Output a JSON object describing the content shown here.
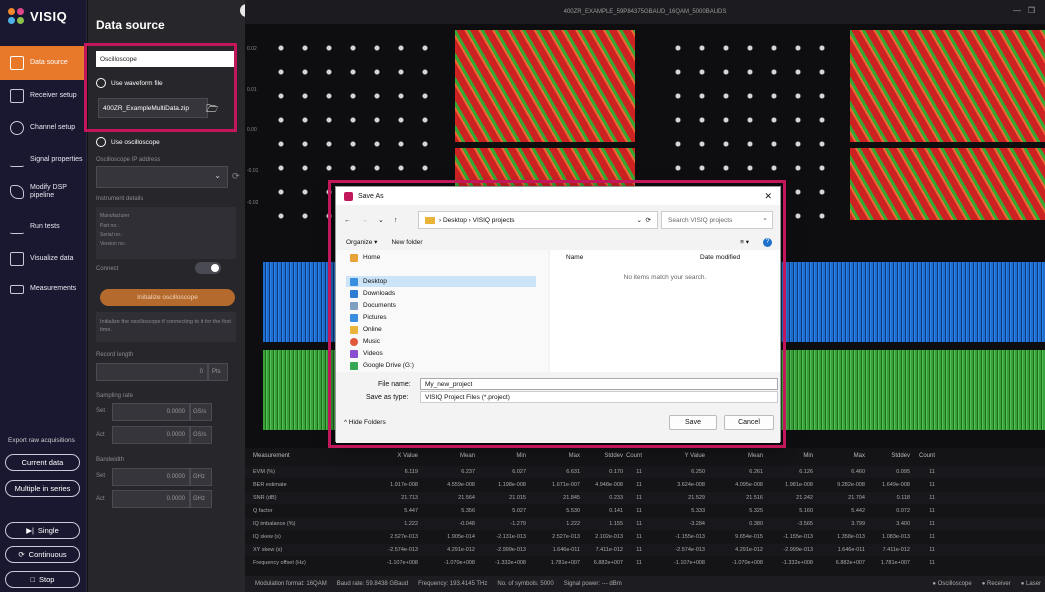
{
  "nav": {
    "logo": "VISIQ",
    "items": [
      {
        "label": "Data source"
      },
      {
        "label": "Receiver setup"
      },
      {
        "label": "Channel setup"
      },
      {
        "label": "Signal properties"
      },
      {
        "label": "Modify DSP pipeline"
      },
      {
        "label": "Run tests"
      },
      {
        "label": "Visualize data"
      },
      {
        "label": "Measurements"
      }
    ],
    "export_title": "Export raw acquisitions",
    "current_data": "Current data",
    "multiple_series": "Multiple in series",
    "single": "Single",
    "continuous": "Continuous",
    "stop": "Stop"
  },
  "panel": {
    "title": "Data source",
    "section": "Oscilloscope",
    "use_waveform": "Use waveform file",
    "waveform_file": "400ZR_ExampleMultiData.zip",
    "use_oscilloscope": "Use oscilloscope",
    "ip_label": "Oscilloscope IP address",
    "instrument_details": "Instrument details",
    "manufacturer": "Manufacturer",
    "part_no": "Part no.:",
    "serial_no": "Serial no.:",
    "version_no": "Version no.:",
    "connect": "Connect",
    "init_button": "Initialize oscilloscope",
    "init_note": "Initialize the oscilloscope if connecting to it for the first time.",
    "record_length": "Record length",
    "record_value": "0",
    "record_unit": "Pts",
    "sampling_rate": "Sampling rate",
    "set": "Set",
    "act": "Act",
    "sr_set": "0.0000",
    "sr_act": "0.0000",
    "sr_unit": "GS/s",
    "bandwidth": "Bandwidth",
    "bw_set": "0.0000",
    "bw_act": "0.0000",
    "bw_unit": "GHz"
  },
  "main": {
    "window_title": "400ZR_EXAMPLE_59P84375GBAUD_16QAM_5000BAUDS",
    "axis": {
      "t1": "0.02",
      "t2": "0.01",
      "t3": "0.00",
      "t4": "-0.01",
      "t5": "-0.02"
    }
  },
  "table": {
    "headers": [
      "Measurement",
      "X Value",
      "Mean",
      "Min",
      "Max",
      "Stddev",
      "Count",
      "Y Value",
      "Mean",
      "Min",
      "Max",
      "Stddev",
      "Count"
    ],
    "rows": [
      [
        "EVM (%)",
        "6.119",
        "6.237",
        "6.027",
        "6.631",
        "0.170",
        "11",
        "6.250",
        "6.261",
        "6.126",
        "6.460",
        "0.095",
        "11"
      ],
      [
        "BER estimate",
        "1.917e-008",
        "4.559e-008",
        "1.198e-008",
        "1.671e-007",
        "4.948e-008",
        "11",
        "3.624e-008",
        "4.095e-008",
        "1.981e-008",
        "9.282e-008",
        "1.649e-008",
        "11"
      ],
      [
        "SNR (dB)",
        "21.713",
        "21.564",
        "21.015",
        "21.845",
        "0.233",
        "11",
        "21.529",
        "21.516",
        "21.242",
        "21.704",
        "0.118",
        "11"
      ],
      [
        "Q factor",
        "5.447",
        "5.356",
        "5.027",
        "5.530",
        "0.141",
        "11",
        "5.333",
        "5.325",
        "5.160",
        "5.442",
        "0.072",
        "11"
      ],
      [
        "IQ imbalance (%)",
        "1.222",
        "-0.048",
        "-1.279",
        "1.222",
        "1.155",
        "11",
        "-3.284",
        "0.380",
        "-3.565",
        "3.799",
        "3.400",
        "11"
      ],
      [
        "IQ skew (s)",
        "2.527e-013",
        "1.905e-014",
        "-2.131e-013",
        "2.527e-013",
        "2.102e-013",
        "11",
        "-1.155e-013",
        "9.654e-015",
        "-1.155e-013",
        "1.358e-013",
        "1.083e-013",
        "11"
      ],
      [
        "XY skew (s)",
        "-2.574e-013",
        "4.291e-012",
        "-2.999e-013",
        "1.646e-011",
        "7.411e-012",
        "11",
        "-2.574e-013",
        "4.291e-012",
        "-2.999e-013",
        "1.646e-011",
        "7.411e-012",
        "11"
      ],
      [
        "Frequency offset (Hz)",
        "-1.107e+008",
        "-1.070e+008",
        "-1.332e+008",
        "1.781e+007",
        "6.882e+007",
        "11",
        "-1.107e+008",
        "-1.070e+008",
        "-1.332e+008",
        "6.882e+007",
        "1.781e+007",
        "11"
      ]
    ]
  },
  "status": {
    "modulation": "Modulation format: 16QAM",
    "baud": "Baud rate: 59.8438 GBaud",
    "frequency": "Frequency: 193.4145 THz",
    "symbols": "No. of symbols: 5000",
    "power": "Signal power: --- dBm",
    "osc": "Oscilloscope",
    "receiver": "Receiver",
    "laser": "Laser"
  },
  "dialog": {
    "title": "Save As",
    "path_desktop": "Desktop",
    "path_folder": "VISIQ projects",
    "search_placeholder": "Search VISIQ projects",
    "organize": "Organize ▾",
    "new_folder": "New folder",
    "tree": [
      "Home",
      "Desktop",
      "Downloads",
      "Documents",
      "Pictures",
      "Online",
      "Music",
      "Videos",
      "Google Drive (G:)"
    ],
    "col_name": "Name",
    "col_date": "Date modified",
    "empty": "No items match your search.",
    "file_name_label": "File name:",
    "file_name": "My_new_project",
    "save_type_label": "Save as type:",
    "save_type": "VISIQ Project Files (*.project)",
    "hide_folders": "Hide Folders",
    "save": "Save",
    "cancel": "Cancel"
  }
}
